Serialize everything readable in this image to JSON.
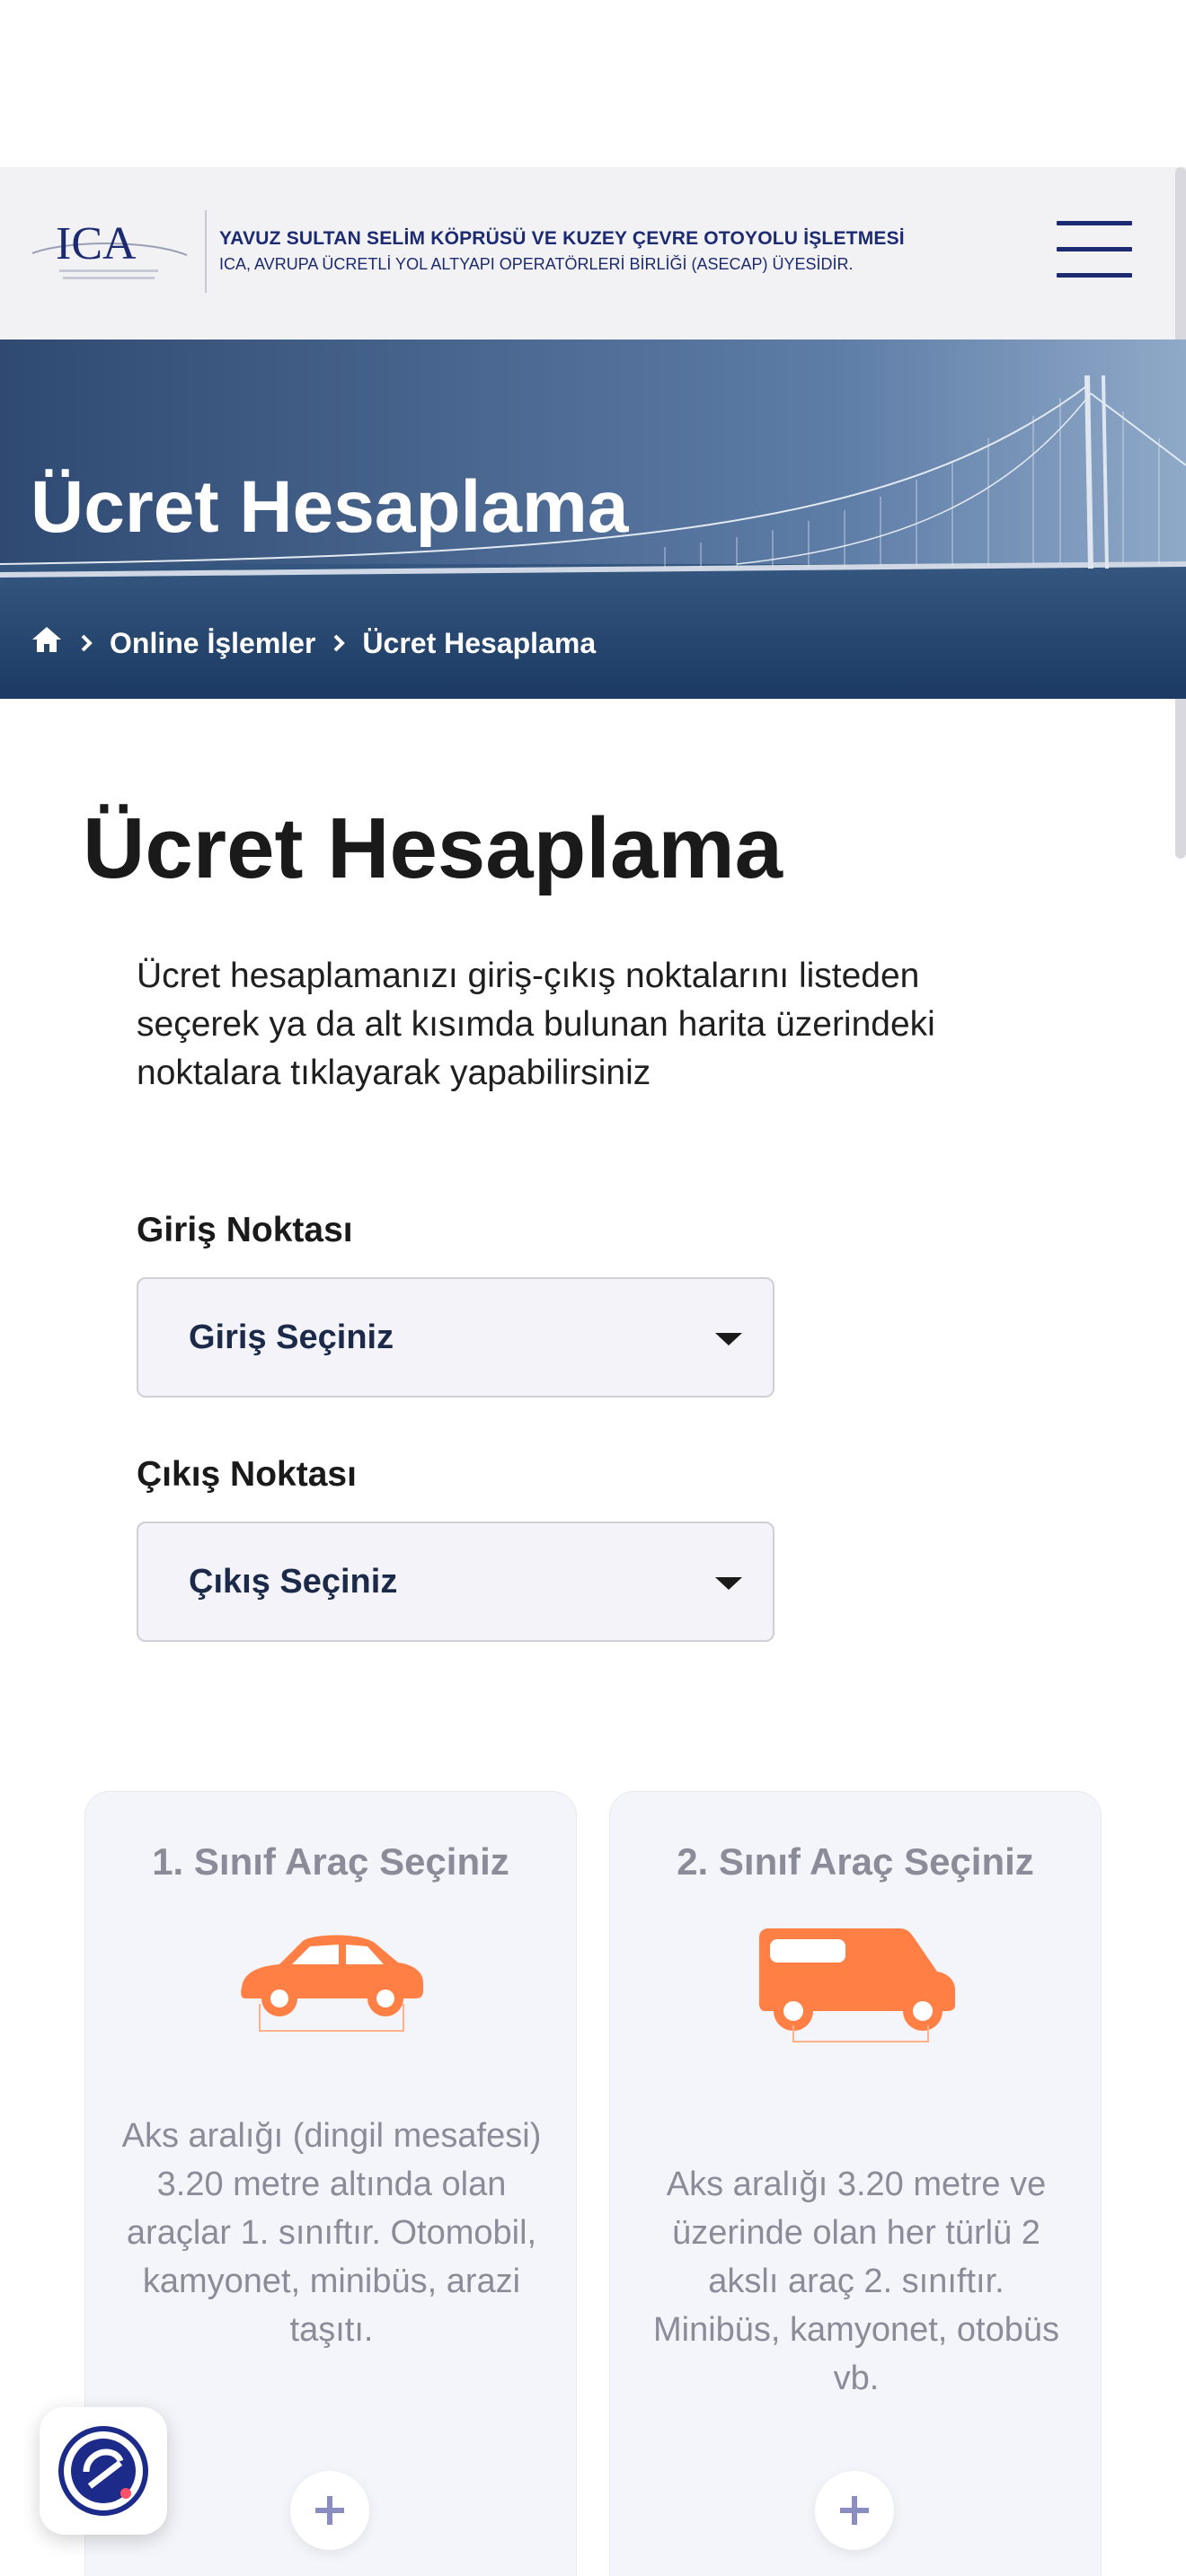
{
  "header": {
    "logo_text": "ICA",
    "brand_line1": "YAVUZ SULTAN SELİM KÖPRÜSÜ VE KUZEY ÇEVRE OTOYOLU İŞLETMESİ",
    "brand_line2": "ICA, AVRUPA ÜCRETLİ YOL ALTYAPI OPERATÖRLERİ BİRLİĞİ (ASECAP) ÜYESİDİR.",
    "menu_icon": "hamburger-menu-icon"
  },
  "hero": {
    "title": "Ücret Hesaplama",
    "breadcrumb": {
      "home_icon": "home-icon",
      "items": [
        "Online İşlemler",
        "Ücret Hesaplama"
      ]
    }
  },
  "main": {
    "title": "Ücret Hesaplama",
    "intro": "Ücret hesaplamanızı giriş-çıkış noktalarını listeden seçerek ya da alt kısımda bulunan harita üzerindeki noktalara tıklayarak yapabilirsiniz",
    "entry": {
      "label": "Giriş Noktası",
      "selected": "Giriş Seçiniz"
    },
    "exit": {
      "label": "Çıkış Noktası",
      "selected": "Çıkış Seçiniz"
    }
  },
  "vehicle_classes": [
    {
      "title": "1. Sınıf Araç Seçiniz",
      "icon": "car-icon",
      "description": "Aks aralığı (dingil mesafesi) 3.20 metre altında olan araçlar 1. sınıftır. Otomobil, kamyonet, minibüs, arazi taşıtı."
    },
    {
      "title": "2. Sınıf Araç Seçiniz",
      "icon": "van-icon",
      "description": "Aks aralığı 3.20 metre ve üzerinde olan her türlü 2 akslı araç 2. sınıftır. Minibüs, kamyonet, otobüs vb."
    }
  ],
  "colors": {
    "brand_navy": "#1c2a72",
    "accent_orange": "#ff7f45",
    "card_bg": "#f4f5fa",
    "muted_text": "#8a8d99"
  },
  "accessibility_icon": "accessibility-widget-icon"
}
